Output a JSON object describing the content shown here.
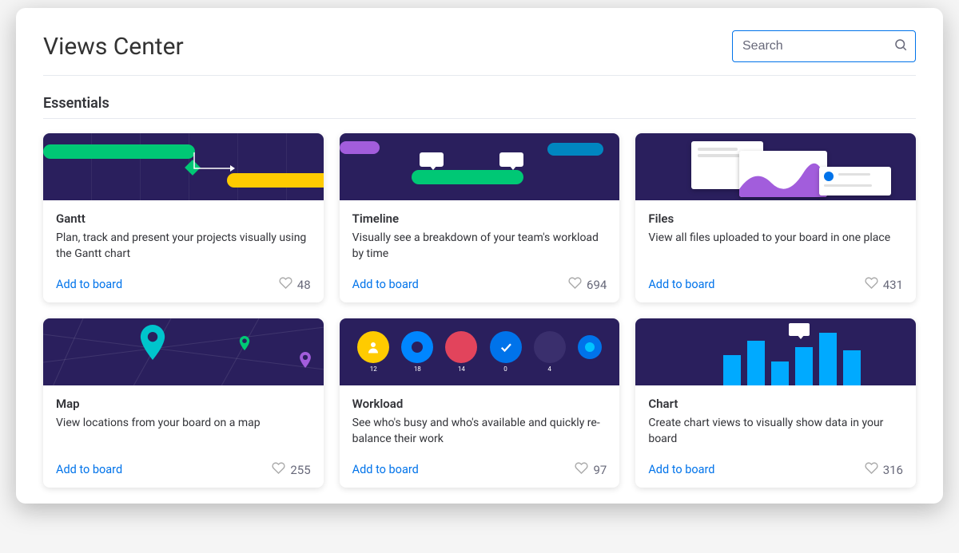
{
  "header": {
    "title": "Views Center",
    "search_placeholder": "Search"
  },
  "section": {
    "title": "Essentials"
  },
  "add_label": "Add to board",
  "cards": [
    {
      "title": "Gantt",
      "desc": "Plan, track and present your projects visually using the Gantt chart",
      "likes": "48"
    },
    {
      "title": "Timeline",
      "desc": "Visually see a breakdown of your team's workload by time",
      "likes": "694"
    },
    {
      "title": "Files",
      "desc": "View all files uploaded to your board in one place",
      "likes": "431"
    },
    {
      "title": "Map",
      "desc": "View locations from your board on a map",
      "likes": "255"
    },
    {
      "title": "Workload",
      "desc": "See who's busy and who's available and quickly re-balance their work",
      "likes": "97",
      "counts": [
        "12",
        "18",
        "14",
        "0",
        "4"
      ]
    },
    {
      "title": "Chart",
      "desc": "Create chart views to visually show data in your board",
      "likes": "316"
    }
  ]
}
